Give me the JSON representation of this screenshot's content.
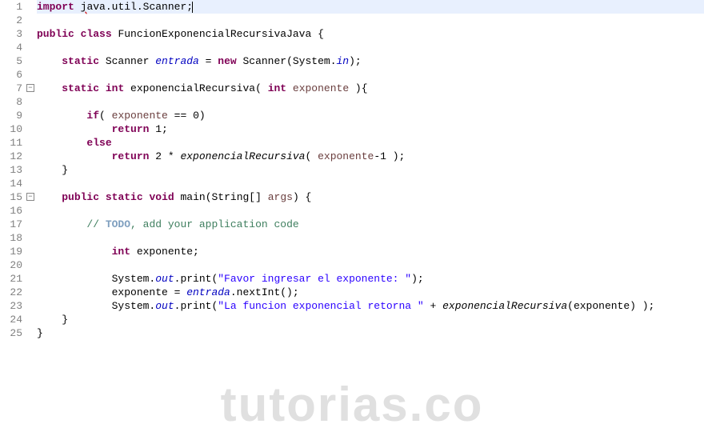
{
  "watermark": "tutorias.co",
  "lines": [
    {
      "num": "1",
      "highlight": true,
      "fold": "",
      "tokens": [
        {
          "cls": "kw",
          "t": "import"
        },
        {
          "cls": "",
          "t": " "
        },
        {
          "cls": "error-underline",
          "t": "j"
        },
        {
          "cls": "",
          "t": "ava.util.Scanner;"
        },
        {
          "cls": "cursor",
          "t": ""
        }
      ]
    },
    {
      "num": "2",
      "highlight": false,
      "fold": "",
      "tokens": [
        {
          "cls": "",
          "t": ""
        }
      ]
    },
    {
      "num": "3",
      "highlight": false,
      "fold": "",
      "tokens": [
        {
          "cls": "kw",
          "t": "public"
        },
        {
          "cls": "",
          "t": " "
        },
        {
          "cls": "kw",
          "t": "class"
        },
        {
          "cls": "",
          "t": " FuncionExponencialRecursivaJava {"
        }
      ]
    },
    {
      "num": "4",
      "highlight": false,
      "fold": "",
      "tokens": [
        {
          "cls": "",
          "t": ""
        }
      ]
    },
    {
      "num": "5",
      "highlight": false,
      "fold": "",
      "tokens": [
        {
          "cls": "",
          "t": "    "
        },
        {
          "cls": "kw",
          "t": "static"
        },
        {
          "cls": "",
          "t": " Scanner "
        },
        {
          "cls": "field-static",
          "t": "entrada"
        },
        {
          "cls": "",
          "t": " = "
        },
        {
          "cls": "kw",
          "t": "new"
        },
        {
          "cls": "",
          "t": " Scanner(System."
        },
        {
          "cls": "field-static",
          "t": "in"
        },
        {
          "cls": "",
          "t": ");"
        }
      ]
    },
    {
      "num": "6",
      "highlight": false,
      "fold": "",
      "tokens": [
        {
          "cls": "",
          "t": ""
        }
      ]
    },
    {
      "num": "7",
      "highlight": false,
      "fold": "minus",
      "tokens": [
        {
          "cls": "",
          "t": "    "
        },
        {
          "cls": "kw",
          "t": "static"
        },
        {
          "cls": "",
          "t": " "
        },
        {
          "cls": "kw",
          "t": "int"
        },
        {
          "cls": "",
          "t": " exponencialRecursiva( "
        },
        {
          "cls": "kw",
          "t": "int"
        },
        {
          "cls": "",
          "t": " "
        },
        {
          "cls": "param",
          "t": "exponente"
        },
        {
          "cls": "",
          "t": " ){"
        }
      ]
    },
    {
      "num": "8",
      "highlight": false,
      "fold": "",
      "tokens": [
        {
          "cls": "",
          "t": ""
        }
      ]
    },
    {
      "num": "9",
      "highlight": false,
      "fold": "",
      "tokens": [
        {
          "cls": "",
          "t": "        "
        },
        {
          "cls": "kw",
          "t": "if"
        },
        {
          "cls": "",
          "t": "( "
        },
        {
          "cls": "param",
          "t": "exponente"
        },
        {
          "cls": "",
          "t": " == 0)"
        }
      ]
    },
    {
      "num": "10",
      "highlight": false,
      "fold": "",
      "tokens": [
        {
          "cls": "",
          "t": "            "
        },
        {
          "cls": "kw",
          "t": "return"
        },
        {
          "cls": "",
          "t": " 1;"
        }
      ]
    },
    {
      "num": "11",
      "highlight": false,
      "fold": "",
      "tokens": [
        {
          "cls": "",
          "t": "        "
        },
        {
          "cls": "kw",
          "t": "else"
        }
      ]
    },
    {
      "num": "12",
      "highlight": false,
      "fold": "",
      "tokens": [
        {
          "cls": "",
          "t": "            "
        },
        {
          "cls": "kw",
          "t": "return"
        },
        {
          "cls": "",
          "t": " 2 * "
        },
        {
          "cls": "method-static",
          "t": "exponencialRecursiva"
        },
        {
          "cls": "",
          "t": "( "
        },
        {
          "cls": "param",
          "t": "exponente"
        },
        {
          "cls": "",
          "t": "-1 );"
        }
      ]
    },
    {
      "num": "13",
      "highlight": false,
      "fold": "",
      "tokens": [
        {
          "cls": "",
          "t": "    }"
        }
      ]
    },
    {
      "num": "14",
      "highlight": false,
      "fold": "",
      "tokens": [
        {
          "cls": "",
          "t": ""
        }
      ]
    },
    {
      "num": "15",
      "highlight": false,
      "fold": "minus",
      "tokens": [
        {
          "cls": "",
          "t": "    "
        },
        {
          "cls": "kw",
          "t": "public"
        },
        {
          "cls": "",
          "t": " "
        },
        {
          "cls": "kw",
          "t": "static"
        },
        {
          "cls": "",
          "t": " "
        },
        {
          "cls": "kw",
          "t": "void"
        },
        {
          "cls": "",
          "t": " main(String[] "
        },
        {
          "cls": "param",
          "t": "args"
        },
        {
          "cls": "",
          "t": ") {"
        }
      ]
    },
    {
      "num": "16",
      "highlight": false,
      "fold": "",
      "tokens": [
        {
          "cls": "",
          "t": ""
        }
      ]
    },
    {
      "num": "17",
      "highlight": false,
      "fold": "",
      "tokens": [
        {
          "cls": "",
          "t": "        "
        },
        {
          "cls": "com",
          "t": "// "
        },
        {
          "cls": "tag-comment",
          "t": "TODO"
        },
        {
          "cls": "com",
          "t": ", add your application code"
        }
      ]
    },
    {
      "num": "18",
      "highlight": false,
      "fold": "",
      "tokens": [
        {
          "cls": "",
          "t": ""
        }
      ]
    },
    {
      "num": "19",
      "highlight": false,
      "fold": "",
      "tokens": [
        {
          "cls": "",
          "t": "            "
        },
        {
          "cls": "kw",
          "t": "int"
        },
        {
          "cls": "",
          "t": " exponente;"
        }
      ]
    },
    {
      "num": "20",
      "highlight": false,
      "fold": "",
      "tokens": [
        {
          "cls": "",
          "t": ""
        }
      ]
    },
    {
      "num": "21",
      "highlight": false,
      "fold": "",
      "tokens": [
        {
          "cls": "",
          "t": "            System."
        },
        {
          "cls": "field-static",
          "t": "out"
        },
        {
          "cls": "",
          "t": ".print("
        },
        {
          "cls": "str",
          "t": "\"Favor ingresar el exponente: \""
        },
        {
          "cls": "",
          "t": ");"
        }
      ]
    },
    {
      "num": "22",
      "highlight": false,
      "fold": "",
      "tokens": [
        {
          "cls": "",
          "t": "            exponente = "
        },
        {
          "cls": "field-static",
          "t": "entrada"
        },
        {
          "cls": "",
          "t": ".nextInt();"
        }
      ]
    },
    {
      "num": "23",
      "highlight": false,
      "fold": "",
      "tokens": [
        {
          "cls": "",
          "t": "            System."
        },
        {
          "cls": "field-static",
          "t": "out"
        },
        {
          "cls": "",
          "t": ".print("
        },
        {
          "cls": "str",
          "t": "\"La funcion exponencial retorna \""
        },
        {
          "cls": "",
          "t": " + "
        },
        {
          "cls": "method-static",
          "t": "exponencialRecursiva"
        },
        {
          "cls": "",
          "t": "(exponente) );"
        }
      ]
    },
    {
      "num": "24",
      "highlight": false,
      "fold": "",
      "tokens": [
        {
          "cls": "",
          "t": "    }"
        }
      ]
    },
    {
      "num": "25",
      "highlight": false,
      "fold": "",
      "tokens": [
        {
          "cls": "",
          "t": "}"
        }
      ]
    }
  ]
}
